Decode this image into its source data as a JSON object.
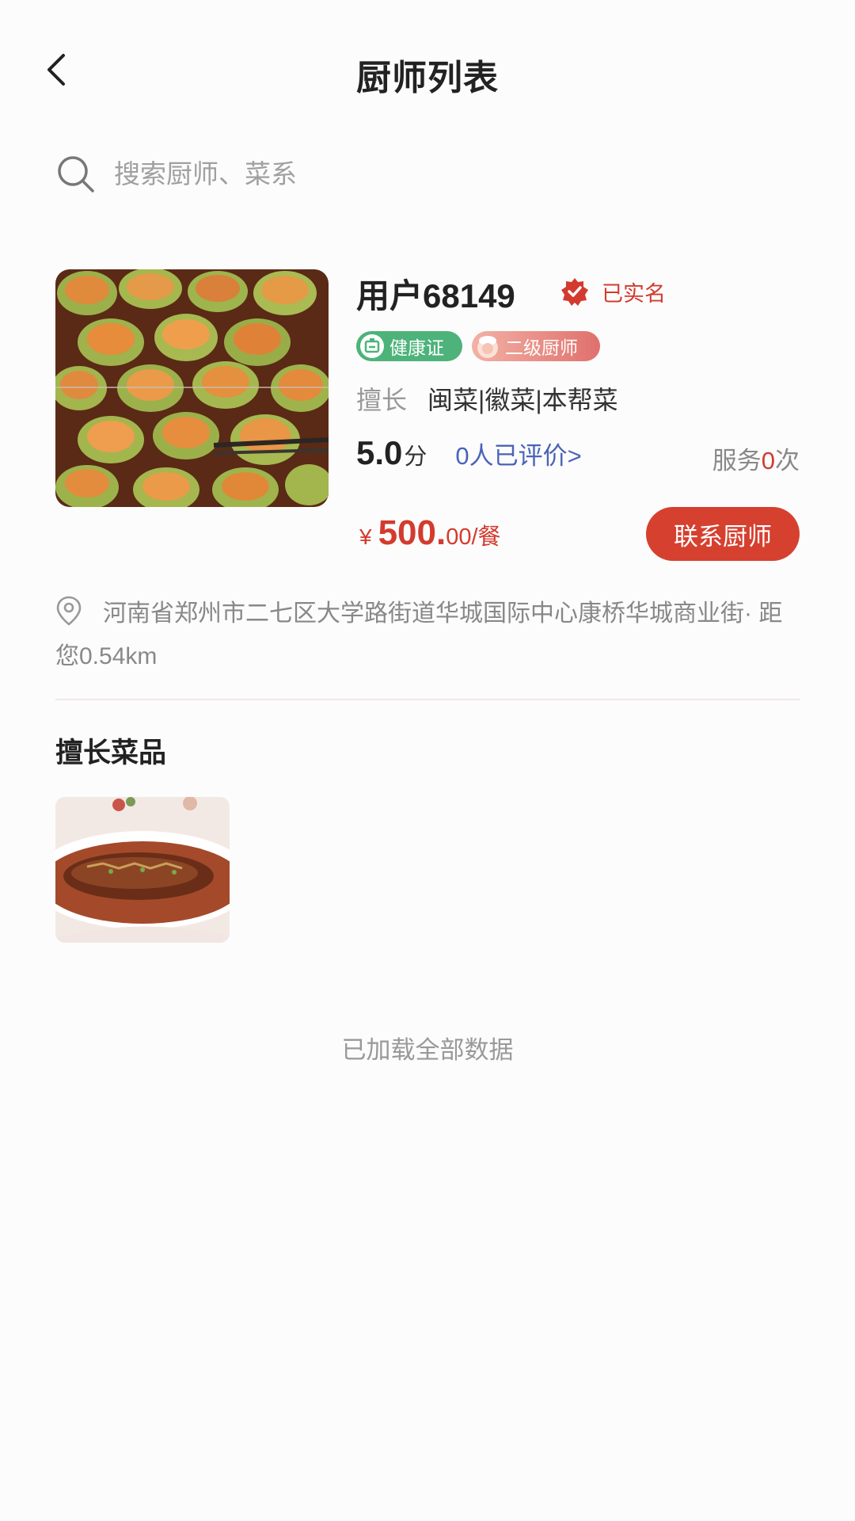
{
  "header": {
    "title": "厨师列表"
  },
  "search": {
    "placeholder": "搜索厨师、菜系"
  },
  "chef": {
    "name": "用户68149",
    "verified_label": "已实名",
    "badges": [
      {
        "label": "健康证",
        "icon": "health-cert-icon"
      },
      {
        "label": "二级厨师",
        "icon": "chef-level-icon"
      }
    ],
    "specialty_label": "擅长",
    "specialty_value": "闽菜|徽菜|本帮菜",
    "score": "5.0",
    "score_unit": "分",
    "reviews_text": "0人已评价>",
    "service_prefix": "服务",
    "service_count": "0",
    "service_suffix": "次",
    "price_currency": "¥",
    "price_integer": "500.",
    "price_suffix": "00/餐",
    "contact_label": "联系厨师",
    "address": "河南省郑州市二七区大学路街道华城国际中心康桥华城商业街· 距您0.54km"
  },
  "dishes_section": {
    "title": "擅长菜品"
  },
  "footer": {
    "text": "已加载全部数据"
  },
  "colors": {
    "accent": "#d6402f",
    "link": "#4a63b8",
    "health_badge": "#4db37a"
  }
}
